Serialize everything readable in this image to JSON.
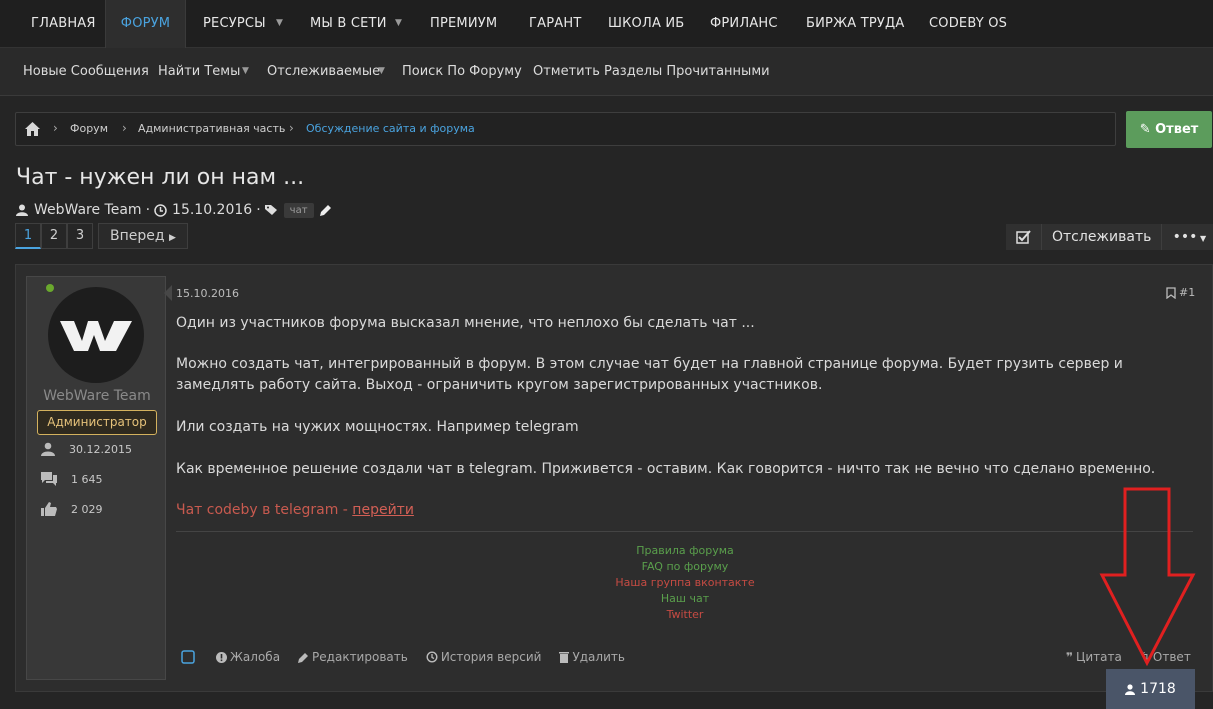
{
  "top_nav": {
    "items": [
      "ГЛАВНАЯ",
      "ФОРУМ",
      "РЕСУРСЫ",
      "МЫ В СЕТИ",
      "ПРЕМИУМ",
      "ГАРАНТ",
      "ШКОЛА ИБ",
      "ФРИЛАНС",
      "БИРЖА ТРУДА",
      "CODEBY OS"
    ],
    "active": "ФОРУМ"
  },
  "sub_nav": {
    "items": [
      "Новые Сообщения",
      "Найти Темы",
      "Отслеживаемые",
      "Поиск По Форуму",
      "Отметить Разделы Прочитанными"
    ]
  },
  "breadcrumb": [
    "Форум",
    "Административная часть",
    "Обсуждение сайта и форума"
  ],
  "reply_button": "Ответ",
  "thread": {
    "title": "Чат - нужен ли он нам ...",
    "author": "WebWare Team",
    "date": "15.10.2016",
    "tag": "чат"
  },
  "pagination": {
    "pages": [
      "1",
      "2",
      "3"
    ],
    "current": "1",
    "next": "Вперед"
  },
  "follow_label": "Отслеживать",
  "post": {
    "author": {
      "name": "WebWare Team",
      "role": "Администратор",
      "joined": "30.12.2015",
      "messages": "1 645",
      "reactions": "2 029"
    },
    "date": "15.10.2016",
    "number": "#1",
    "paragraphs": [
      "Один из участников форума высказал мнение, что неплохо бы сделать чат ...",
      "Можно создать чат, интегрированный в форум. В этом случае чат будет на главной странице форума. Будет грузить сервер и замедлять работу сайта. Выход - ограничить кругом зарегистрированных участников.",
      "Или создать на чужих мощностях. Например telegram",
      "Как временное решение создали чат в telegram. Приживется - оставим. Как говорится - ничто так не вечно что сделано временно."
    ],
    "telegram_text": "Чат codeby в telegram - ",
    "telegram_link": "перейти",
    "signature_links": [
      "Правила форума",
      "FAQ по форуму",
      "Наша группа вконтакте",
      "Наш чат",
      "Twitter"
    ],
    "actions": [
      "Жалоба",
      "Редактировать",
      "История версий",
      "Удалить"
    ],
    "actions_right": [
      "Цитата",
      "Ответ"
    ]
  },
  "views_badge": "1718",
  "colors": {
    "accent": "#4aa3df",
    "reply_green": "#5c9c5c",
    "role_gold": "#d4b25e",
    "annotation_red": "#e02020"
  }
}
